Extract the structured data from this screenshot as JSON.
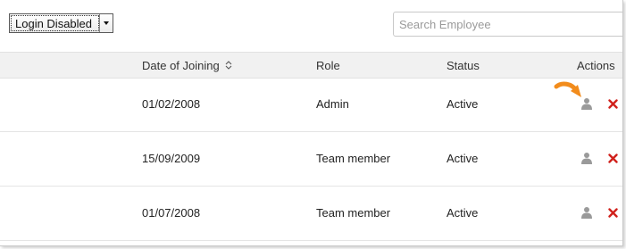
{
  "filter": {
    "selected": "Login Disabled"
  },
  "search": {
    "placeholder": "Search Employee",
    "value": ""
  },
  "table": {
    "columns": [
      {
        "key": "date",
        "label": "Date of Joining",
        "sortable": true
      },
      {
        "key": "role",
        "label": "Role"
      },
      {
        "key": "status",
        "label": "Status"
      },
      {
        "key": "actions",
        "label": "Actions"
      }
    ],
    "rows": [
      {
        "date": "01/02/2008",
        "role": "Admin",
        "status": "Active"
      },
      {
        "date": "15/09/2009",
        "role": "Team member",
        "status": "Active"
      },
      {
        "date": "01/07/2008",
        "role": "Team member",
        "status": "Active"
      }
    ]
  },
  "icons": {
    "user_action": "user-icon",
    "delete_action": "close-icon",
    "pointer": "orange-arrow-pointer"
  },
  "colors": {
    "header_bg": "#f1f1f1",
    "delete_red": "#d0211c",
    "user_grey": "#9a9a9a",
    "pointer_orange": "#f28c1c"
  }
}
